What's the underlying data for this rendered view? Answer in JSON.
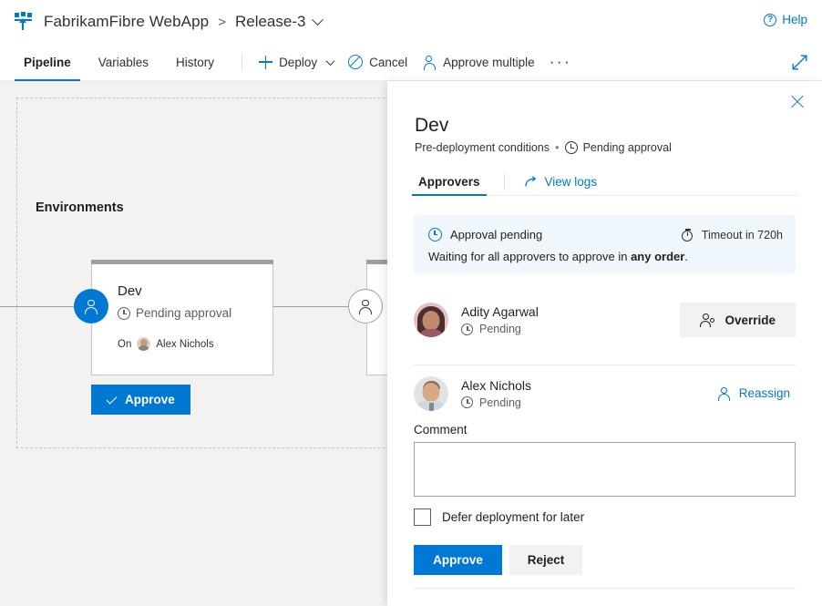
{
  "header": {
    "pipeline_icon": "release-pipeline-icon",
    "project_name": "FabrikamFibre WebApp",
    "breadcrumb_separator": ">",
    "release_name": "Release-3",
    "release_dropdown_icon": "chevron-down-icon",
    "help_label": "Help",
    "help_icon": "question-circle-icon"
  },
  "commandbar": {
    "tabs": [
      {
        "label": "Pipeline",
        "active": true
      },
      {
        "label": "Variables",
        "active": false
      },
      {
        "label": "History",
        "active": false
      }
    ],
    "deploy_label": "Deploy",
    "deploy_icon": "plus-icon",
    "deploy_chevron_icon": "chevron-down-icon",
    "cancel_label": "Cancel",
    "cancel_icon": "ban-circle-icon",
    "approve_multiple_label": "Approve multiple",
    "approve_multiple_icon": "person-icon",
    "more_label": "···",
    "more_icon": "ellipsis-icon",
    "expand_icon": "expand-diagonal-icon"
  },
  "canvas": {
    "section_title": "Environments",
    "env_card": {
      "name": "Dev",
      "status": "Pending approval",
      "status_icon": "clock-icon",
      "on_label": "On",
      "on_user": "Alex Nichols",
      "on_user_avatar": "avatar-alex-nichols"
    },
    "pre_approval_node_icon": "person-icon",
    "post_approval_node_icon": "person-icon",
    "approve_cta_label": "Approve",
    "approve_cta_icon": "checkmark-icon"
  },
  "panel": {
    "close_icon": "close-icon",
    "title": "Dev",
    "subtitle_prefix": "Pre-deployment conditions",
    "subtitle_bullet": "•",
    "subtitle_status_icon": "clock-icon",
    "subtitle_status": "Pending approval",
    "tabs": [
      {
        "label": "Approvers",
        "active": true
      },
      {
        "label": "View logs",
        "active": false,
        "icon": "share-arrow-icon"
      }
    ],
    "notice": {
      "icon": "clock-icon",
      "title": "Approval pending",
      "message_before": "Waiting for all approvers to approve in ",
      "message_strong": "any order",
      "message_after": ".",
      "timeout_icon": "timer-icon",
      "timeout_label": "Timeout in 720h"
    },
    "approvers": [
      {
        "name": "Adity Agarwal",
        "status": "Pending",
        "status_icon": "clock-icon",
        "avatar": "avatar-adity-agarwal",
        "action_label": "Override",
        "action_icon": "people-icon",
        "action_style": "button"
      },
      {
        "name": "Alex Nichols",
        "status": "Pending",
        "status_icon": "clock-icon",
        "avatar": "avatar-alex-nichols",
        "action_label": "Reassign",
        "action_icon": "person-icon",
        "action_style": "link"
      }
    ],
    "comment": {
      "label": "Comment",
      "value": "",
      "placeholder": ""
    },
    "defer": {
      "label": "Defer deployment for later",
      "checked": false
    },
    "actions": {
      "approve_label": "Approve",
      "reject_label": "Reject"
    }
  },
  "colors": {
    "accent": "#0078d4",
    "canvas_bg": "#f3f2f1",
    "notice_bg": "#eff6fc",
    "neutral_button": "#f3f2f1",
    "card_header": "#a19f9d",
    "text_primary": "#201f1e",
    "text_secondary": "#605e5c"
  }
}
